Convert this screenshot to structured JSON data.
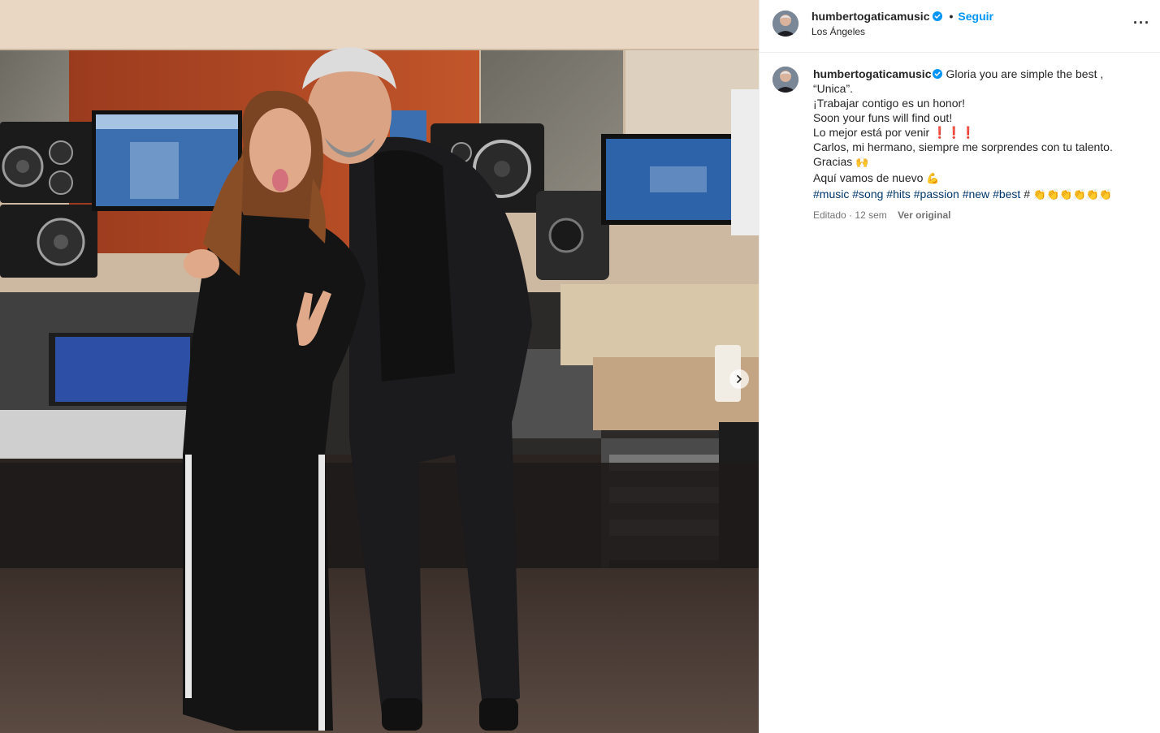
{
  "header": {
    "username": "humbertogaticamusic",
    "separator": "•",
    "follow_label": "Seguir",
    "location": "Los Ángeles",
    "more_label": "···"
  },
  "caption": {
    "username": "humbertogaticamusic",
    "lines": [
      "Gloria you are simple the best ,",
      "“Unica”.",
      "¡Trabajar contigo es un honor!",
      "Soon your funs will find out!",
      "Lo mejor está por venir",
      "Carlos, mi hermano, siempre me sorprendes con tu talento.",
      "Gracias",
      "Aquí vamos de nuevo"
    ],
    "emojis": {
      "exclaim": "❗❗❗",
      "hands": "🙌",
      "muscle": "💪",
      "clap": "👏👏👏👏👏👏"
    },
    "hashtags": [
      "#music",
      "#song",
      "#hits",
      "#passion",
      "#new",
      "#best",
      "#"
    ],
    "edited": "Editado",
    "dot": "·",
    "time": "12 sem",
    "see_original": "Ver original"
  },
  "media": {
    "description_icon": "photo",
    "next_icon": "chevron-right-icon"
  },
  "colors": {
    "link_blue": "#0095f6",
    "hashtag": "#00376b",
    "verified": "#0095f6"
  }
}
